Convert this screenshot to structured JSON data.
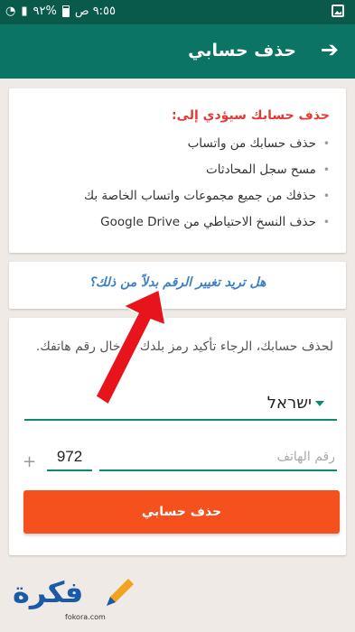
{
  "status_bar": {
    "time": "٩:٥٥ ص",
    "battery": "%٩٢"
  },
  "app_bar": {
    "title": "حذف حسابي",
    "back_icon": "arrow-right-icon"
  },
  "info_card": {
    "heading": "حذف حسابك سيؤدي إلى:",
    "items": [
      "حذف حسابك من واتساب",
      "مسح سجل المحادثات",
      "حذفك من جميع مجموعات واتساب الخاصة بك",
      "حذف النسخ الاحتياطي من Google Drive"
    ]
  },
  "change_number": {
    "link": "هل تريد تغيير الرقم بدلاً من ذلك؟"
  },
  "form": {
    "description": "لحذف حسابك، الرجاء تأكيد رمز بلدك وإدخال رقم هاتفك.",
    "country": "ישראל",
    "plus": "+",
    "country_code": "972",
    "phone_placeholder": "رقم الهاتف",
    "delete_button": "حذف حسابي"
  },
  "watermark": {
    "brand": "فكرة",
    "domain": "fokora.com"
  },
  "colors": {
    "status_bar": "#0a5a4c",
    "app_bar": "#0b7465",
    "accent": "#0b8a6e",
    "danger_text": "#e53935",
    "button": "#f4511e",
    "link": "#3b7fc4",
    "arrow": "#e8141c"
  }
}
